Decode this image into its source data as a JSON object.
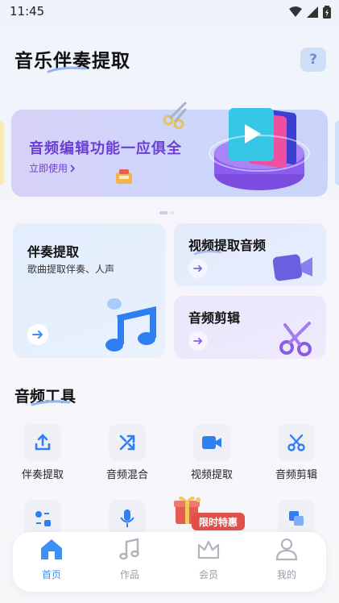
{
  "status": {
    "time": "11:45"
  },
  "header": {
    "title": "音乐伴奏提取",
    "help_label": "?"
  },
  "banner": {
    "title": "音频编辑功能一应俱全",
    "link_label": "立即使用"
  },
  "cards": {
    "accomp": {
      "title": "伴奏提取",
      "subtitle": "歌曲提取伴奏、人声"
    },
    "video": {
      "title": "视频提取音频"
    },
    "cut": {
      "title": "音频剪辑"
    }
  },
  "tools": {
    "section_title": "音频工具",
    "items": [
      {
        "label": "伴奏提取",
        "icon": "upload-icon"
      },
      {
        "label": "音频混合",
        "icon": "shuffle-icon"
      },
      {
        "label": "视频提取",
        "icon": "video-icon"
      },
      {
        "label": "音频剪辑",
        "icon": "scissors-icon"
      }
    ]
  },
  "promo": {
    "label": "限时特惠"
  },
  "tabbar": {
    "items": [
      {
        "label": "首页",
        "icon": "home-icon",
        "active": true
      },
      {
        "label": "作品",
        "icon": "music-note-icon",
        "active": false
      },
      {
        "label": "会员",
        "icon": "crown-icon",
        "active": false
      },
      {
        "label": "我的",
        "icon": "person-icon",
        "active": false
      }
    ]
  },
  "colors": {
    "accent": "#3b8ff5",
    "banner_text": "#6b3fd6",
    "promo": "#e14f4a"
  }
}
